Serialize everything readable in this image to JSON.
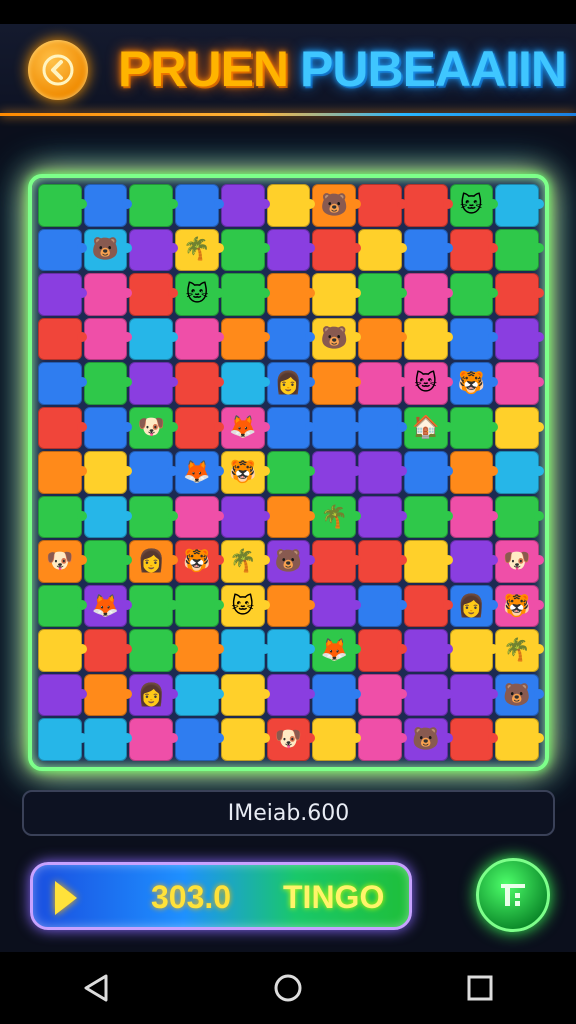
{
  "header": {
    "title_left": "PRUEN",
    "title_right": "PUBEAAIIN",
    "back_icon": "chevron-left-icon"
  },
  "board": {
    "columns": 11,
    "rows": 13,
    "palette": [
      "#2f7df0",
      "#f0453a",
      "#ffd02a",
      "#2fc84a",
      "#8a3ee0",
      "#ff8a1a",
      "#ef4fa8",
      "#26b6e8"
    ]
  },
  "info": {
    "text": "IMeiab.600"
  },
  "play_bar": {
    "score": "303.0",
    "label": "TINGO",
    "icon": "play-icon"
  },
  "menu_button": {
    "icon": "grid-menu-icon"
  },
  "navigation": {
    "back": "nav-back-icon",
    "home": "nav-home-icon",
    "recents": "nav-recents-icon"
  }
}
